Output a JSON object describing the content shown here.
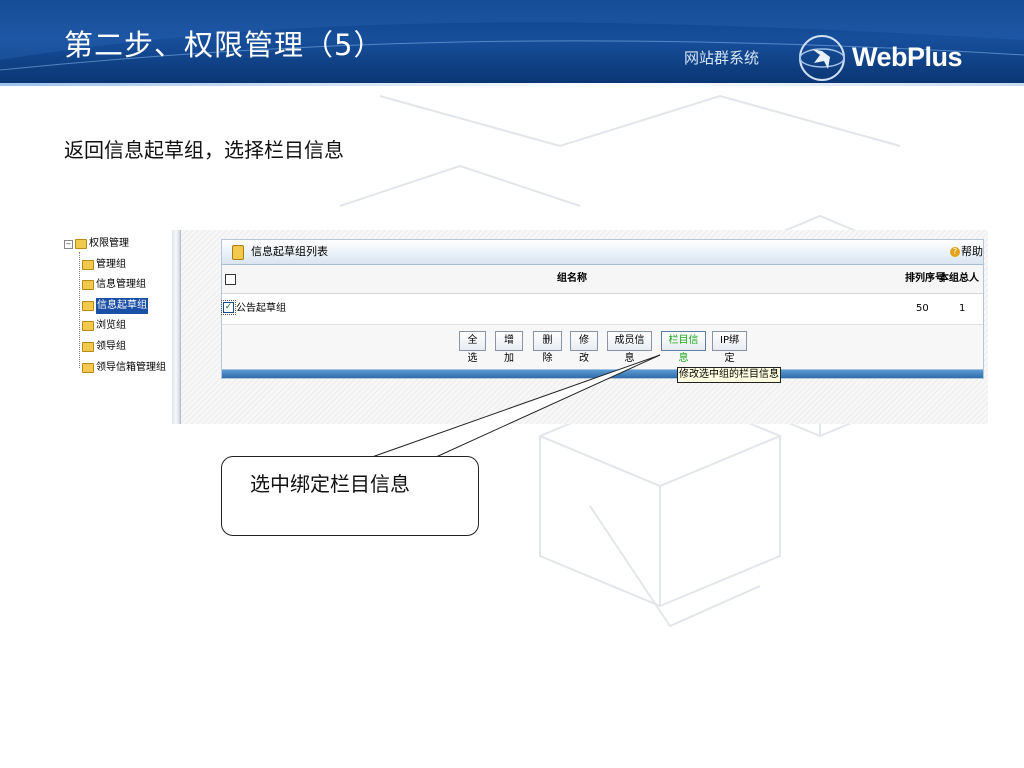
{
  "slide": {
    "title": "第二步、权限管理（5）",
    "subtitle": "返回信息起草组，选择栏目信息"
  },
  "brand": {
    "system_name": "网站群系统",
    "logo_text": "WebPlus"
  },
  "colors": {
    "banner": "#174f9c",
    "selected_tree": "#1a4fa6",
    "active_button_text": "#1aa81a",
    "tooltip_bg": "#ffffe1"
  },
  "tree": {
    "root_label": "权限管理",
    "items": [
      {
        "label": "管理组",
        "selected": false
      },
      {
        "label": "信息管理组",
        "selected": false
      },
      {
        "label": "信息起草组",
        "selected": true
      },
      {
        "label": "浏览组",
        "selected": false
      },
      {
        "label": "领导组",
        "selected": false
      },
      {
        "label": "领导信箱管理组",
        "selected": false
      }
    ]
  },
  "panel": {
    "title": "信息起草组列表",
    "help_label": "帮助",
    "columns": {
      "name": "组名称",
      "order": "排列序号",
      "count": "本组总人数"
    },
    "rows": [
      {
        "name": "公告起草组",
        "order": "50",
        "count": "1",
        "checked": true
      }
    ],
    "buttons": [
      {
        "label": "全选",
        "active": false
      },
      {
        "label": "增加",
        "active": false
      },
      {
        "label": "删除",
        "active": false
      },
      {
        "label": "修改",
        "active": false
      },
      {
        "label": "成员信息",
        "active": false
      },
      {
        "label": "栏目信息",
        "active": true
      },
      {
        "label": "IP绑定",
        "active": false
      }
    ],
    "tooltip": "修改选中组的栏目信息"
  },
  "callout": {
    "text": "选中绑定栏目信息"
  }
}
